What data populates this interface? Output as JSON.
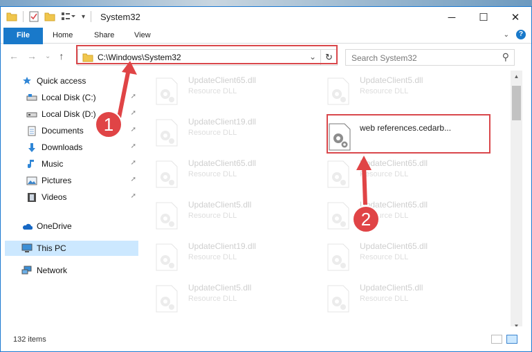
{
  "window": {
    "title": "System32",
    "controls": {
      "minimize": "─",
      "maximize": "☐",
      "close": "✕"
    }
  },
  "ribbon": {
    "tabs": [
      {
        "label": "File"
      },
      {
        "label": "Home"
      },
      {
        "label": "Share"
      },
      {
        "label": "View"
      }
    ],
    "help": "?"
  },
  "navigation": {
    "back": "←",
    "forward": "→",
    "recent": "⌄",
    "up": "↑",
    "address": "C:\\Windows\\System32",
    "dropdown": "⌄",
    "refresh": "↻"
  },
  "search": {
    "placeholder": "Search System32",
    "icon": "⚲"
  },
  "sidebar": {
    "items": [
      {
        "label": "Quick access",
        "icon": "star-icon"
      },
      {
        "label": "Local Disk (C:)",
        "icon": "drive-icon",
        "pinned": true
      },
      {
        "label": "Local Disk (D:)",
        "icon": "drive-icon",
        "pinned": true
      },
      {
        "label": "Documents",
        "icon": "document-icon",
        "pinned": true
      },
      {
        "label": "Downloads",
        "icon": "download-icon",
        "pinned": true
      },
      {
        "label": "Music",
        "icon": "music-icon",
        "pinned": true
      },
      {
        "label": "Pictures",
        "icon": "pictures-icon",
        "pinned": true
      },
      {
        "label": "Videos",
        "icon": "videos-icon",
        "pinned": true
      },
      {
        "label": "OneDrive",
        "icon": "cloud-icon"
      },
      {
        "label": "This PC",
        "icon": "computer-icon",
        "selected": true
      },
      {
        "label": "Network",
        "icon": "network-icon"
      }
    ],
    "pin_glyph": "📌"
  },
  "files": {
    "left": [
      {
        "name": "UpdateClient65.dll",
        "type": "Resource DLL"
      },
      {
        "name": "UpdateClient19.dll",
        "type": "Resource DLL"
      },
      {
        "name": "UpdateClient65.dll",
        "type": "Resource DLL"
      },
      {
        "name": "UpdateClient5.dll",
        "type": "Resource DLL"
      },
      {
        "name": "UpdateClient19.dll",
        "type": "Resource DLL"
      },
      {
        "name": "UpdateClient5.dll",
        "type": "Resource DLL"
      }
    ],
    "right": [
      {
        "name": "UpdateClient5.dll",
        "type": "Resource DLL"
      },
      {
        "name": "web references.cedarb...",
        "type": "",
        "highlighted": true
      },
      {
        "name": "UpdateClient65.dll",
        "type": "Resource DLL"
      },
      {
        "name": "UpdateClient65.dll",
        "type": "Resource DLL"
      },
      {
        "name": "UpdateClient65.dll",
        "type": "Resource DLL"
      },
      {
        "name": "UpdateClient5.dll",
        "type": "Resource DLL"
      }
    ]
  },
  "status": {
    "item_count": "132 items"
  },
  "annotations": {
    "step1": "1",
    "step2": "2",
    "color": "#e04446"
  }
}
